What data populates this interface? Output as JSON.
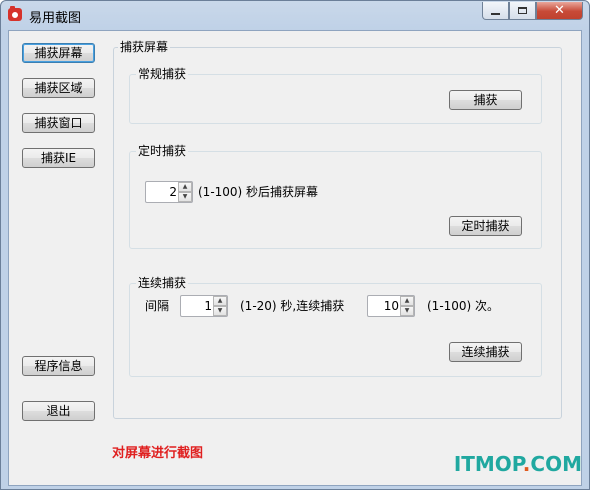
{
  "window": {
    "title": "易用截图",
    "close_glyph": "✕"
  },
  "sidebar": {
    "capture_screen": "捕获屏幕",
    "capture_region": "捕获区域",
    "capture_window": "捕获窗口",
    "capture_ie": "捕获IE",
    "about": "程序信息",
    "exit": "退出"
  },
  "panel": {
    "title": "捕获屏幕",
    "normal": {
      "label": "常规捕获",
      "button": "捕获"
    },
    "timed": {
      "label": "定时捕获",
      "delay_value": "2",
      "delay_text": "(1-100) 秒后捕获屏幕",
      "button": "定时捕获"
    },
    "continuous": {
      "label": "连续捕获",
      "interval_label": "间隔",
      "interval_value": "1",
      "interval_text": "(1-20) 秒,连续捕获",
      "count_value": "10",
      "count_text": "(1-100) 次。",
      "button": "连续捕获"
    }
  },
  "status": "对屏幕进行截图",
  "watermark": {
    "prefix": "ITMOP",
    "dot": ".",
    "suffix": "COM"
  },
  "colors": {
    "status": "#e02020",
    "watermark": "#20a8a0",
    "close": "#c74a37"
  }
}
